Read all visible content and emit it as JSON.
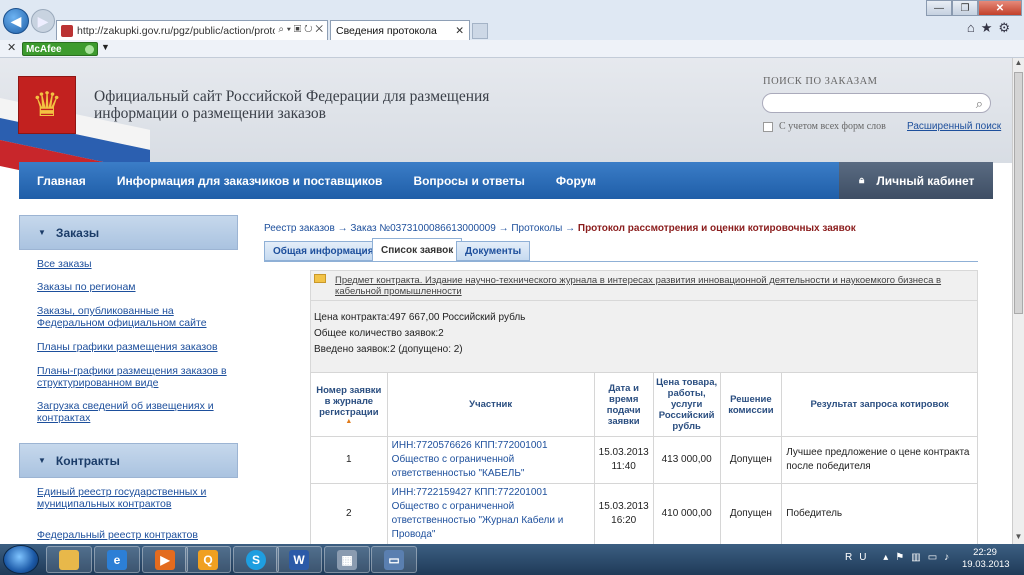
{
  "browser": {
    "url": "http://zakupki.gov.ru/pgz/public/action/protoc",
    "tab_title": "Сведения протокола",
    "addon": "McAfee"
  },
  "header": {
    "site_title_line1": "Официальный сайт Российской Федерации для размещения",
    "site_title_line2": "информации о размещении заказов",
    "search_label": "ПОИСК ПО ЗАКАЗАМ",
    "search_placeholder": "",
    "all_forms_label": "С учетом всех форм слов",
    "advanced_search": "Расширенный поиск"
  },
  "menu": {
    "items": [
      "Главная",
      "Информация для заказчиков и поставщиков",
      "Вопросы и ответы",
      "Форум"
    ],
    "cabinet": "Личный кабинет"
  },
  "sidebar": {
    "orders_title": "Заказы",
    "orders_links": [
      "Все заказы",
      "Заказы по регионам",
      "Заказы, опубликованные на Федеральном официальном сайте",
      "Планы графики размещения заказов",
      "Планы-графики размещения заказов в структурированном виде",
      "Загрузка сведений об извещениях и контрактах"
    ],
    "contracts_title": "Контракты",
    "contracts_links": [
      "Единый реестр государственных и муниципальных контрактов",
      "Федеральный реестр контрактов"
    ]
  },
  "breadcrumbs": {
    "c1": "Реестр заказов",
    "c2": "Заказ №0373100086613000009",
    "c3": "Протоколы",
    "current": "Протокол рассмотрения и оценки котировочных заявок",
    "sep": "→"
  },
  "tabs": [
    "Общая информация",
    "Список заявок",
    "Документы"
  ],
  "subject": "Предмет контракта. Издание научно-технического журнала в интересах развития инновационной деятельности и наукоемкого бизнеса в кабельной промышленности",
  "summary": {
    "price": "Цена контракта:497 667,00 Российский рубль",
    "total": "Общее количество заявок:2",
    "entered": "Введено заявок:2 (допущено: 2)"
  },
  "table": {
    "headers": [
      "Номер заявки в журнале регистрации",
      "Участник",
      "Дата и время подачи заявки",
      "Цена товара, работы, услуги Российский рубль",
      "Решение комиссии",
      "Результат запроса котировок"
    ],
    "rows": [
      {
        "num": "1",
        "participant": "ИНН:7720576626 КПП:772001001 Общество с ограниченной ответственностью \"КАБЕЛЬ\"",
        "date": "15.03.2013",
        "time": "11:40",
        "price": "413 000,00",
        "decision": "Допущен",
        "result": "Лучшее предложение о цене контракта после победителя"
      },
      {
        "num": "2",
        "participant": "ИНН:7722159427 КПП:772201001 Общество с ограниченной ответственностью \"Журнал Кабели и Провода\"",
        "date": "15.03.2013",
        "time": "16:20",
        "price": "410 000,00",
        "decision": "Допущен",
        "result": "Победитель"
      }
    ]
  },
  "taskbar": {
    "lang": "RU",
    "time": "22:29",
    "date": "19.03.2013"
  }
}
